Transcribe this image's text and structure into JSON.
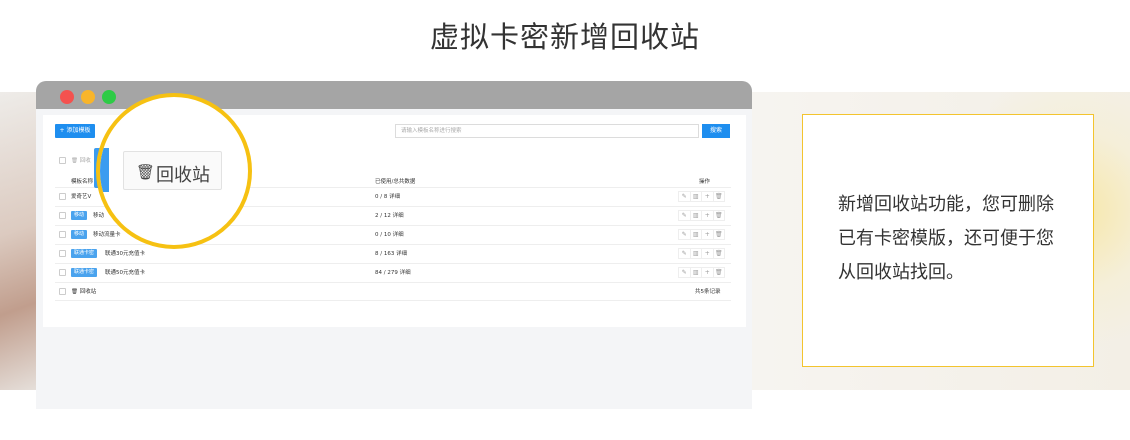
{
  "page_title": "虚拟卡密新增回收站",
  "toolbar": {
    "add_label": "+ 添加模板",
    "search_placeholder": "请输入模板名称进行搜索",
    "search_label": "搜索"
  },
  "table": {
    "batch_delete_label": "🗑 回收",
    "headers": {
      "name": "模板名称",
      "used": "已使用/总共数据",
      "ops": "操作"
    },
    "rows": [
      {
        "tag": "",
        "name": "爱奇艺V",
        "used": "0 / 8 详细"
      },
      {
        "tag": "移动",
        "name": "移动",
        "used": "2 / 12 详细"
      },
      {
        "tag": "移动",
        "name": "移动流量卡",
        "used": "0 / 10 详细"
      },
      {
        "tag": "联通卡密",
        "name": "联通30元充值卡",
        "used": "8 / 163 详细"
      },
      {
        "tag": "联通卡密",
        "name": "联通50元充值卡",
        "used": "84 / 279 详细"
      }
    ],
    "footer_bin_label": "🗑 回收站",
    "total_label": "共5条记录",
    "ops_icons": [
      "edit-icon",
      "chart-icon",
      "plus-icon",
      "trash-icon"
    ]
  },
  "lens": {
    "icon": "🗑",
    "label": "回收站"
  },
  "card": {
    "description": "新增回收站功能，您可删除已有卡密模版，还可便于您从回收站找回。"
  },
  "colors": {
    "accent": "#1e8eef",
    "highlight": "#f6c112",
    "card_border": "#f3c42e"
  }
}
